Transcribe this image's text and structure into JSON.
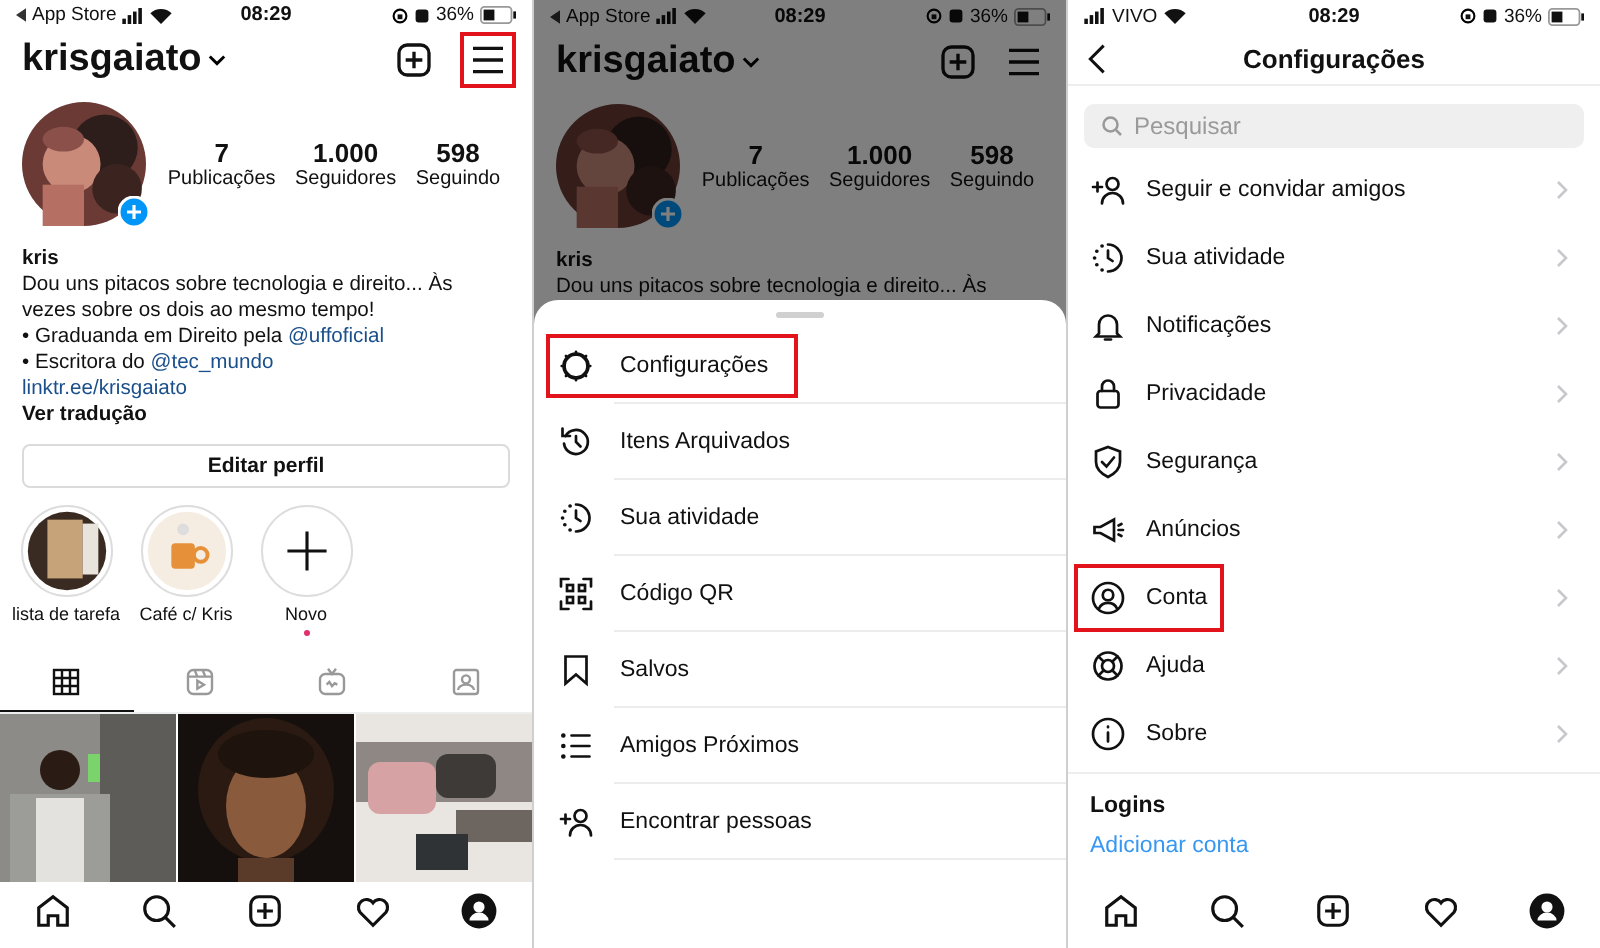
{
  "profile_screen": {
    "status_bar": {
      "back_label": "App Store",
      "time": "08:29",
      "battery": "36%"
    },
    "header": {
      "username": "krisgaiato",
      "menu_highlighted": true
    },
    "stats": [
      {
        "value": "7",
        "label": "Publicações"
      },
      {
        "value": "1.000",
        "label": "Seguidores"
      },
      {
        "value": "598",
        "label": "Seguindo"
      }
    ],
    "name": "kris",
    "bio": [
      {
        "text": "Dou uns pitacos sobre tecnologia e direito... Às vezes sobre os dois ao mesmo tempo!"
      },
      {
        "text": "• Graduanda em Direito pela ",
        "link": "@uffoficial"
      },
      {
        "text": "• Escritora do ",
        "link": "@tec_mundo"
      },
      {
        "link": "linktr.ee/krisgaiato"
      }
    ],
    "translate": "Ver tradução",
    "edit_button": "Editar perfil",
    "highlights": [
      {
        "label": "lista de tarefa"
      },
      {
        "label": "Café c/ Kris"
      },
      {
        "label": "Novo",
        "kind": "new"
      }
    ],
    "tabs": [
      {
        "selected": true
      },
      {
        "selected": false
      },
      {
        "selected": false
      },
      {
        "selected": false
      }
    ]
  },
  "menu_screen": {
    "status_bar": {
      "back_label": "App Store",
      "time": "08:29",
      "battery": "36%"
    },
    "username": "krisgaiato",
    "stats": [
      {
        "value": "7",
        "label": "Publicações"
      },
      {
        "value": "1.000",
        "label": "Seguidores"
      },
      {
        "value": "598",
        "label": "Seguindo"
      }
    ],
    "name": "kris",
    "bio_line": "Dou uns pitacos sobre tecnologia e direito... Às",
    "menu": [
      {
        "label": "Configurações",
        "highlighted": true
      },
      {
        "label": "Itens Arquivados",
        "highlighted": false
      },
      {
        "label": "Sua atividade",
        "highlighted": false
      },
      {
        "label": "Código QR",
        "highlighted": false
      },
      {
        "label": "Salvos",
        "highlighted": false
      },
      {
        "label": "Amigos Próximos",
        "highlighted": false
      },
      {
        "label": "Encontrar pessoas",
        "highlighted": false
      }
    ]
  },
  "settings_screen": {
    "status_bar": {
      "carrier": "VIVO",
      "time": "08:29",
      "battery": "36%"
    },
    "title": "Configurações",
    "search": {
      "placeholder": "Pesquisar"
    },
    "items": [
      {
        "label": "Seguir e convidar amigos",
        "highlighted": false
      },
      {
        "label": "Sua atividade",
        "highlighted": false
      },
      {
        "label": "Notificações",
        "highlighted": false
      },
      {
        "label": "Privacidade",
        "highlighted": false
      },
      {
        "label": "Segurança",
        "highlighted": false
      },
      {
        "label": "Anúncios",
        "highlighted": false
      },
      {
        "label": "Conta",
        "highlighted": true
      },
      {
        "label": "Ajuda",
        "highlighted": false
      },
      {
        "label": "Sobre",
        "highlighted": false
      }
    ],
    "section": "Logins",
    "add_account": "Adicionar conta"
  }
}
